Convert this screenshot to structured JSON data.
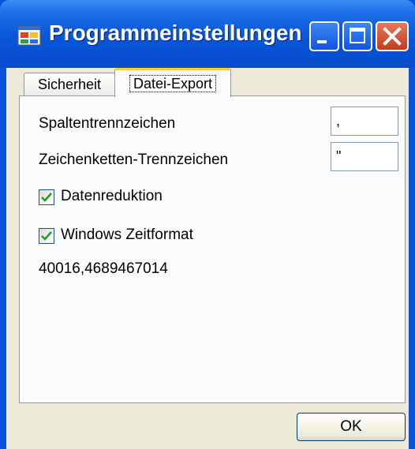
{
  "window": {
    "title": "Programmeinstellungen",
    "icon": "app-settings-icon",
    "controls": [
      "minimize-icon",
      "maximize-icon",
      "close-icon"
    ]
  },
  "tabs": [
    {
      "label": "Sicherheit",
      "selected": false
    },
    {
      "label": "Datei-Export",
      "selected": true
    }
  ],
  "export": {
    "column_separator_label": "Spaltentrennzeichen",
    "column_separator_value": ",",
    "string_separator_label": "Zeichenketten-Trennzeichen",
    "string_separator_value": "\"",
    "data_reduction_label": "Datenreduktion",
    "data_reduction_checked": true,
    "windows_time_label": "Windows Zeitformat",
    "windows_time_checked": true,
    "time_value": "40016,4689467014"
  },
  "buttons": {
    "ok_label": "OK"
  },
  "colors": {
    "titlebar": "#0a58dc",
    "dialog_bg": "#ece9d8",
    "tab_focus": "#ffc83c",
    "close_button": "#c63a1c"
  }
}
